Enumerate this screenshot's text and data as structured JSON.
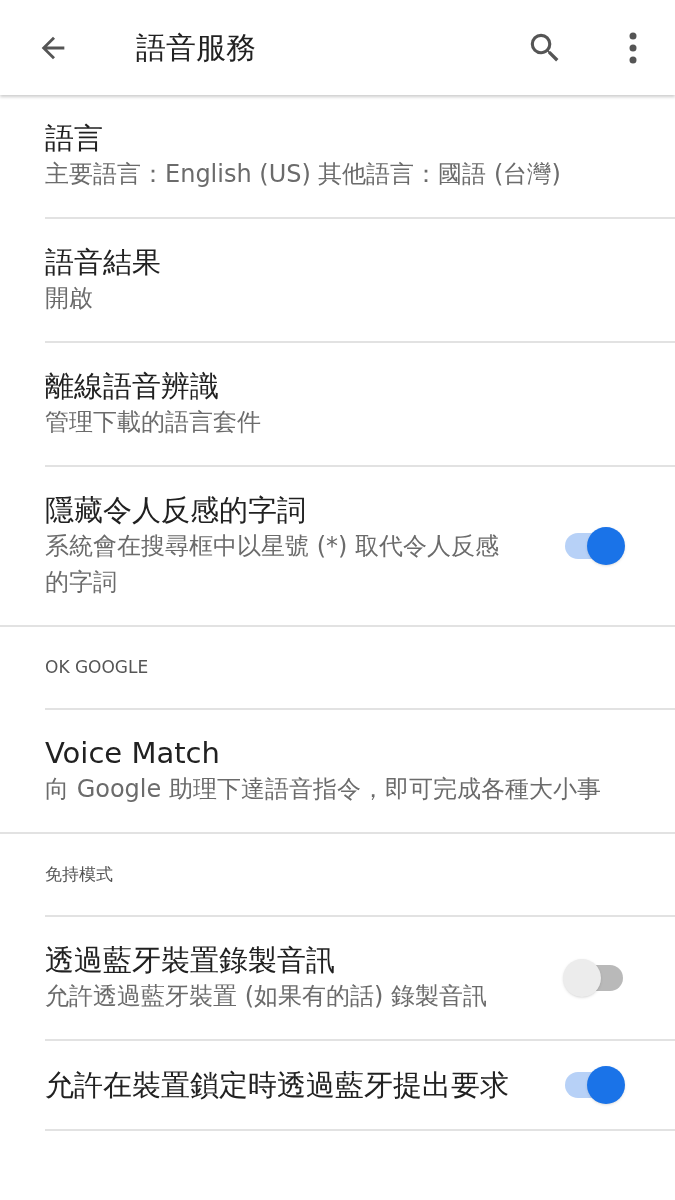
{
  "app_bar": {
    "title": "語音服務"
  },
  "settings": [
    {
      "kind": "item",
      "title": "語言",
      "subtitle": "主要語言：English (US) 其他語言：國語 (台灣)"
    },
    {
      "kind": "item",
      "title": "語音結果",
      "subtitle": "開啟"
    },
    {
      "kind": "item",
      "title": "離線語音辨識",
      "subtitle": "管理下載的語言套件"
    },
    {
      "kind": "toggle",
      "title": "隱藏令人反感的字詞",
      "subtitle": "系統會在搜尋框中以星號 (*) 取代令人反感的字詞",
      "on": true
    },
    {
      "kind": "header",
      "title": "OK GOOGLE"
    },
    {
      "kind": "item",
      "title": "Voice Match",
      "subtitle": "向 Google 助理下達語音指令，即可完成各種大小事"
    },
    {
      "kind": "header",
      "title": "免持模式"
    },
    {
      "kind": "toggle",
      "title": "透過藍牙裝置錄製音訊",
      "subtitle": "允許透過藍牙裝置 (如果有的話) 錄製音訊",
      "on": false
    },
    {
      "kind": "toggle",
      "title": "允許在裝置鎖定時透過藍牙提出要求",
      "on": true
    }
  ]
}
